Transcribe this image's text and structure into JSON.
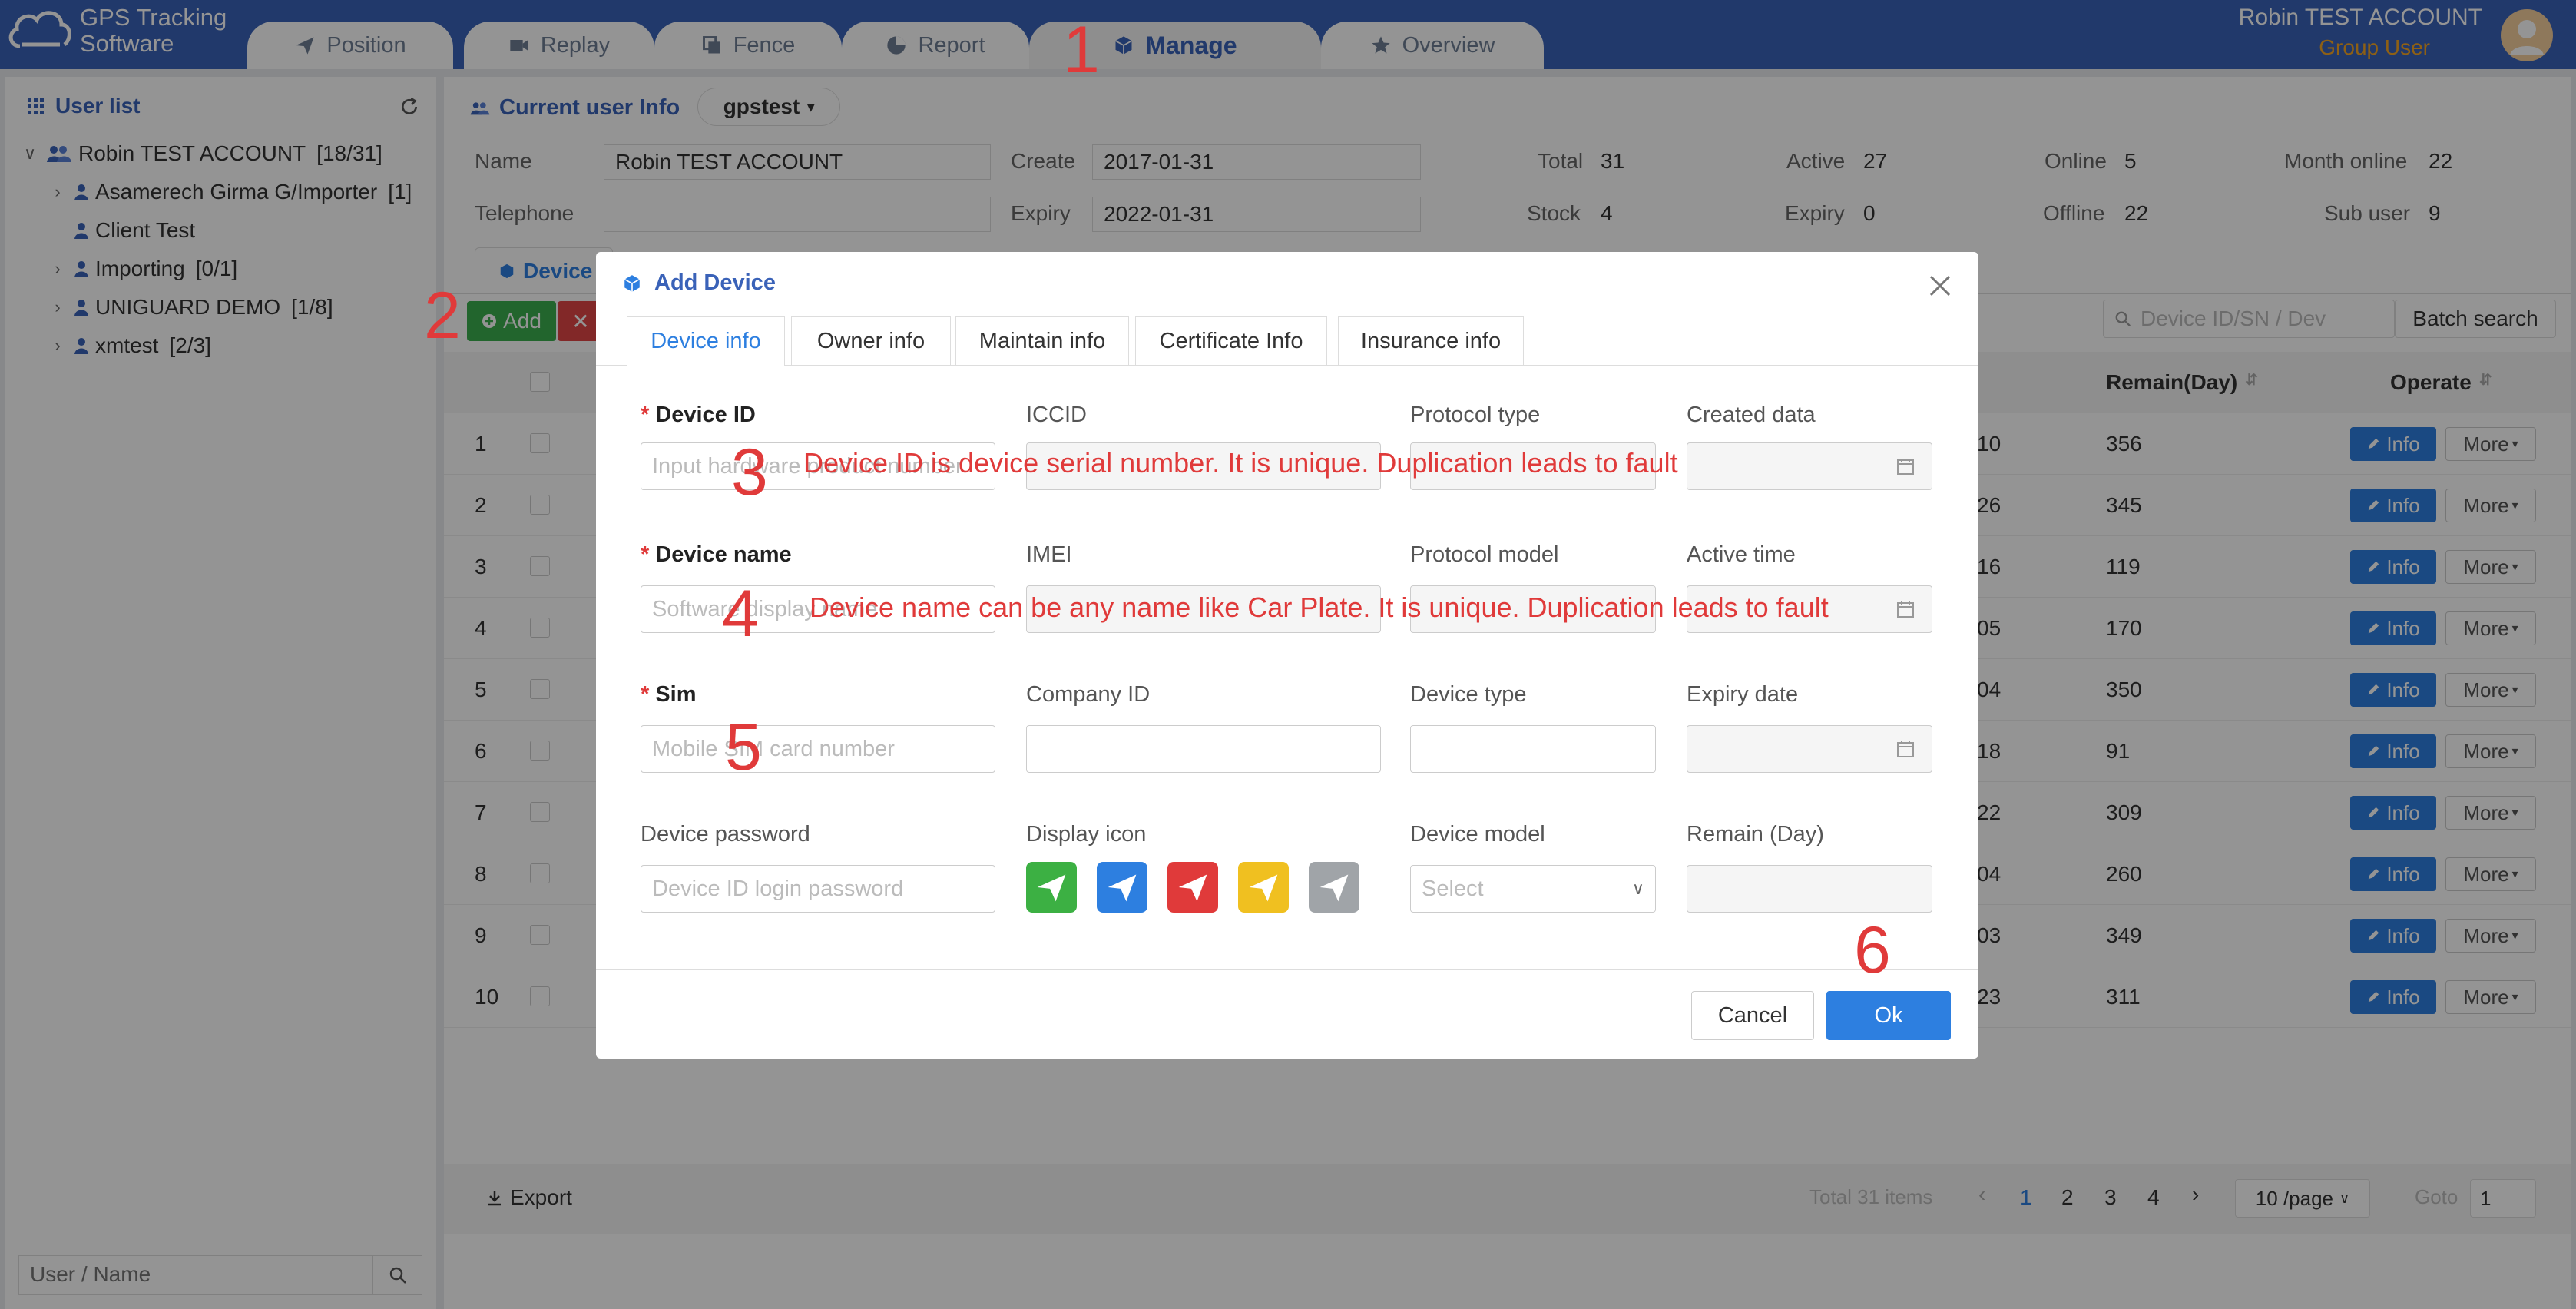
{
  "app": {
    "logo_line1": "GPS Tracking",
    "logo_line2": "Software"
  },
  "nav": {
    "tabs": [
      {
        "label": "Position",
        "icon": "send-icon"
      },
      {
        "label": "Replay",
        "icon": "video-icon"
      },
      {
        "label": "Fence",
        "icon": "copy-icon"
      },
      {
        "label": "Report",
        "icon": "pie-icon"
      },
      {
        "label": "Manage",
        "icon": "cube-icon",
        "active": true
      },
      {
        "label": "Overview",
        "icon": "star-icon"
      }
    ]
  },
  "account": {
    "name": "Robin TEST ACCOUNT",
    "role": "Group User"
  },
  "sidebar": {
    "title": "User list",
    "tree": [
      {
        "label": "Robin TEST ACCOUNT",
        "count": "[18/31]"
      },
      {
        "label": "Asamerech Girma G/Importer",
        "count": "[1]"
      },
      {
        "label": "Client Test",
        "count": ""
      },
      {
        "label": "Importing",
        "count": "[0/1]"
      },
      {
        "label": "UNIGUARD DEMO",
        "count": "[1/8]"
      },
      {
        "label": "xmtest",
        "count": "[2/3]"
      }
    ],
    "search_placeholder": "User / Name"
  },
  "current_user": {
    "title": "Current user Info",
    "dropdown": "gpstest",
    "name_label": "Name",
    "name_value": "Robin TEST ACCOUNT",
    "telephone_label": "Telephone",
    "telephone_value": "",
    "create_label": "Create",
    "create_value": "2017-01-31",
    "expiry_label": "Expiry",
    "expiry_value": "2022-01-31",
    "stats": [
      {
        "label": "Total",
        "value": "31"
      },
      {
        "label": "Active",
        "value": "27"
      },
      {
        "label": "Online",
        "value": "5"
      },
      {
        "label": "Month online",
        "value": "22"
      },
      {
        "label": "Stock",
        "value": "4"
      },
      {
        "label": "Expiry",
        "value": "0"
      },
      {
        "label": "Offline",
        "value": "22"
      },
      {
        "label": "Sub user",
        "value": "9"
      }
    ]
  },
  "table": {
    "tab_label": "Device",
    "add_label": "Add",
    "search_placeholder": "Device ID/SN / Dev",
    "batch_search": "Batch search",
    "col_remain": "Remain(Day)",
    "col_operate": "Operate",
    "info_label": "Info",
    "more_label": "More",
    "rows": [
      {
        "no": "1",
        "mid": "10",
        "remain": "356"
      },
      {
        "no": "2",
        "mid": "26",
        "remain": "345"
      },
      {
        "no": "3",
        "mid": "16",
        "remain": "119"
      },
      {
        "no": "4",
        "mid": "05",
        "remain": "170"
      },
      {
        "no": "5",
        "mid": "04",
        "remain": "350"
      },
      {
        "no": "6",
        "mid": "18",
        "remain": "91"
      },
      {
        "no": "7",
        "mid": "22",
        "remain": "309"
      },
      {
        "no": "8",
        "mid": "04",
        "remain": "260"
      },
      {
        "no": "9",
        "mid": "03",
        "remain": "349"
      },
      {
        "no": "10",
        "mid": "23",
        "remain": "311"
      }
    ],
    "export_label": "Export",
    "total_text": "Total 31 items",
    "pages": [
      "1",
      "2",
      "3",
      "4"
    ],
    "per_page": "10 /page",
    "goto_label": "Goto",
    "goto_value": "1"
  },
  "modal": {
    "title": "Add Device",
    "tabs": [
      "Device info",
      "Owner info",
      "Maintain info",
      "Certificate Info",
      "Insurance info"
    ],
    "fields": {
      "device_id": {
        "label": "Device ID",
        "placeholder": "Input hardware product number"
      },
      "iccid": {
        "label": "ICCID"
      },
      "protocol_type": {
        "label": "Protocol type"
      },
      "created_data": {
        "label": "Created data"
      },
      "device_name": {
        "label": "Device name",
        "placeholder": "Software display name"
      },
      "imei": {
        "label": "IMEI"
      },
      "protocol_model": {
        "label": "Protocol model"
      },
      "active_time": {
        "label": "Active time"
      },
      "sim": {
        "label": "Sim",
        "placeholder": "Mobile SIM card number"
      },
      "company_id": {
        "label": "Company ID"
      },
      "device_type": {
        "label": "Device type"
      },
      "expiry_date": {
        "label": "Expiry date"
      },
      "device_password": {
        "label": "Device password",
        "placeholder": "Device ID login password"
      },
      "display_icon": {
        "label": "Display icon",
        "colors": [
          "#3cb043",
          "#2d7fe0",
          "#e03a3a",
          "#f0c020",
          "#a0a4a8"
        ]
      },
      "device_model": {
        "label": "Device model",
        "placeholder": "Select"
      },
      "remain": {
        "label": "Remain (Day)"
      }
    },
    "cancel": "Cancel",
    "ok": "Ok"
  },
  "annotations": {
    "n1": "1",
    "n2": "2",
    "n3": "3",
    "n4": "4",
    "n5": "5",
    "n6": "6",
    "t3": "Device ID is device serial number. It is unique. Duplication leads to fault",
    "t4": "Device name can be any name like Car Plate. It is unique. Duplication leads to fault"
  }
}
